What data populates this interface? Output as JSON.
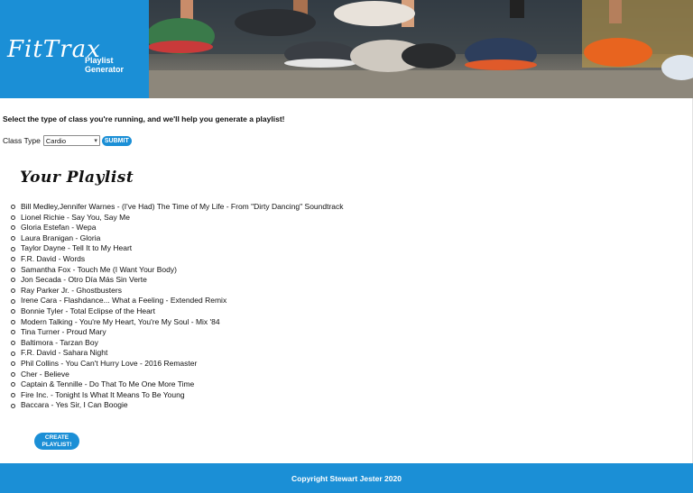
{
  "header": {
    "logo": "FitTrax",
    "subtitle": "Playlist Generator"
  },
  "intro_text": "Select the type of class you're running, and we'll help you generate a playlist!",
  "form": {
    "class_type_label": "Class Type",
    "class_type_value": "Cardio",
    "submit_label": "SUBMIT"
  },
  "playlist": {
    "title": "Your Playlist",
    "songs": [
      "Bill Medley,Jennifer Warnes - (I've Had) The Time of My Life - From \"Dirty Dancing\" Soundtrack",
      "Lionel Richie - Say You, Say Me",
      "Gloria Estefan - Wepa",
      "Laura Branigan - Gloria",
      "Taylor Dayne - Tell It to My Heart",
      "F.R. David - Words",
      "Samantha Fox - Touch Me (I Want Your Body)",
      "Jon Secada - Otro Día Más Sin Verte",
      "Ray Parker Jr. - Ghostbusters",
      "Irene Cara - Flashdance... What a Feeling - Extended Remix",
      "Bonnie Tyler - Total Eclipse of the Heart",
      "Modern Talking - You're My Heart, You're My Soul - Mix '84",
      "Tina Turner - Proud Mary",
      "Baltimora - Tarzan Boy",
      "F.R. David - Sahara Night",
      "Phil Collins - You Can't Hurry Love - 2016 Remaster",
      "Cher - Believe",
      "Captain & Tennille - Do That To Me One More Time",
      "Fire Inc. - Tonight Is What It Means To Be Young",
      "Baccara - Yes Sir, I Can Boogie"
    ]
  },
  "create_button": {
    "line1": "CREATE",
    "line2": "PLAYLIST!"
  },
  "footer": {
    "copyright": "Copyright Stewart Jester 2020"
  },
  "colors": {
    "brand_blue": "#1b8fd6"
  }
}
